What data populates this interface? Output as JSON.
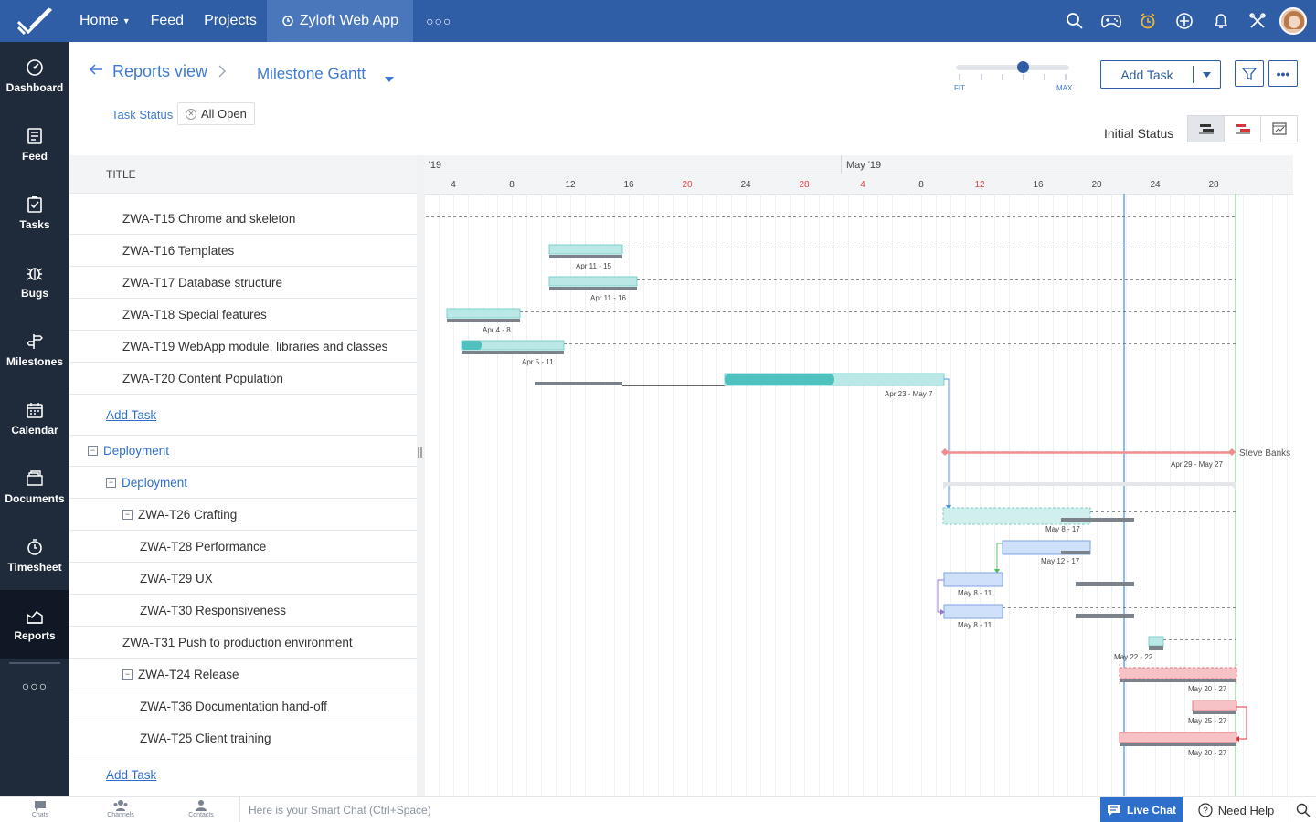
{
  "topnav": {
    "items": [
      {
        "label": "Home"
      },
      {
        "label": "Feed"
      },
      {
        "label": "Projects"
      }
    ],
    "active_project": "Zyloft Web App"
  },
  "sidebar": {
    "items": [
      {
        "label": "Dashboard",
        "icon": "dashboard-icon"
      },
      {
        "label": "Feed",
        "icon": "feed-icon"
      },
      {
        "label": "Tasks",
        "icon": "tasks-icon"
      },
      {
        "label": "Bugs",
        "icon": "bug-icon"
      },
      {
        "label": "Milestones",
        "icon": "milestone-icon"
      },
      {
        "label": "Calendar",
        "icon": "calendar-icon"
      },
      {
        "label": "Documents",
        "icon": "documents-icon"
      },
      {
        "label": "Timesheet",
        "icon": "timesheet-icon"
      },
      {
        "label": "Reports",
        "icon": "reports-icon",
        "active": true
      }
    ]
  },
  "header": {
    "breadcrumb": "Reports view",
    "view_name": "Milestone Gantt",
    "filter_label": "Task Status",
    "filter_value": "All Open",
    "zoom": {
      "fit_label": "FIT",
      "max_label": "MAX",
      "level": 0.6
    },
    "add_task_label": "Add Task",
    "initial_status_label": "Initial Status"
  },
  "tasklist": {
    "title_header": "TITLE",
    "rows": [
      {
        "label": "ZWA-T15 Chrome and skeleton"
      },
      {
        "label": "ZWA-T16 Templates"
      },
      {
        "label": "ZWA-T17 Database structure"
      },
      {
        "label": "ZWA-T18 Special features"
      },
      {
        "label": "ZWA-T19 WebApp module, libraries and classes"
      },
      {
        "label": "ZWA-T20 Content Population"
      },
      {
        "label": "Add Task"
      },
      {
        "label": "Deployment"
      },
      {
        "label": "Deployment"
      },
      {
        "label": "ZWA-T26 Crafting"
      },
      {
        "label": "ZWA-T28 Performance"
      },
      {
        "label": "ZWA-T29 UX"
      },
      {
        "label": "ZWA-T30 Responsiveness"
      },
      {
        "label": "ZWA-T31 Push to production environment"
      },
      {
        "label": "ZWA-T24 Release"
      },
      {
        "label": "ZWA-T36 Documentation hand-off"
      },
      {
        "label": "ZWA-T25 Client training"
      },
      {
        "label": "Add Task"
      }
    ]
  },
  "gantt": {
    "months": [
      {
        "label": "r '19"
      },
      {
        "label": "May '19"
      }
    ],
    "days": [
      {
        "label": "4"
      },
      {
        "label": "8"
      },
      {
        "label": "12"
      },
      {
        "label": "16"
      },
      {
        "label": "20",
        "weekend": true
      },
      {
        "label": "24"
      },
      {
        "label": "28",
        "weekend": true
      },
      {
        "label": "4",
        "weekend": true
      },
      {
        "label": "8"
      },
      {
        "label": "12",
        "weekend": true
      },
      {
        "label": "16"
      },
      {
        "label": "20"
      },
      {
        "label": "24"
      },
      {
        "label": "28"
      }
    ],
    "bars": [
      {
        "dates": "Apr 11 - 15"
      },
      {
        "dates": "Apr 11 - 16"
      },
      {
        "dates": "Apr 4 - 8"
      },
      {
        "dates": "Apr 5 - 11"
      },
      {
        "dates": "Apr 23 - May 7"
      },
      {
        "dates": "Apr 29 - May 27",
        "owner": "Steve Banks"
      },
      {
        "dates": "May 8 - 17"
      },
      {
        "dates": "May 12 - 17"
      },
      {
        "dates": "May 8 - 11"
      },
      {
        "dates": "May 8 - 11"
      },
      {
        "dates": "May 22 - 22"
      },
      {
        "dates": "May 20 - 27"
      },
      {
        "dates": "May 25 - 27"
      },
      {
        "dates": "May 20 - 27"
      }
    ],
    "colors": {
      "teal": "#b9e8e6",
      "teal_dark": "#4fc1bf",
      "blue": "#cfe0fb",
      "pink": "#f6c2c6",
      "baseline": "#7b8289"
    }
  },
  "bottombar": {
    "tabs": [
      {
        "label": "Chats"
      },
      {
        "label": "Channels"
      },
      {
        "label": "Contacts"
      }
    ],
    "chat_placeholder": "Here is your Smart Chat (Ctrl+Space)",
    "live_chat_label": "Live Chat",
    "need_help_label": "Need Help"
  }
}
